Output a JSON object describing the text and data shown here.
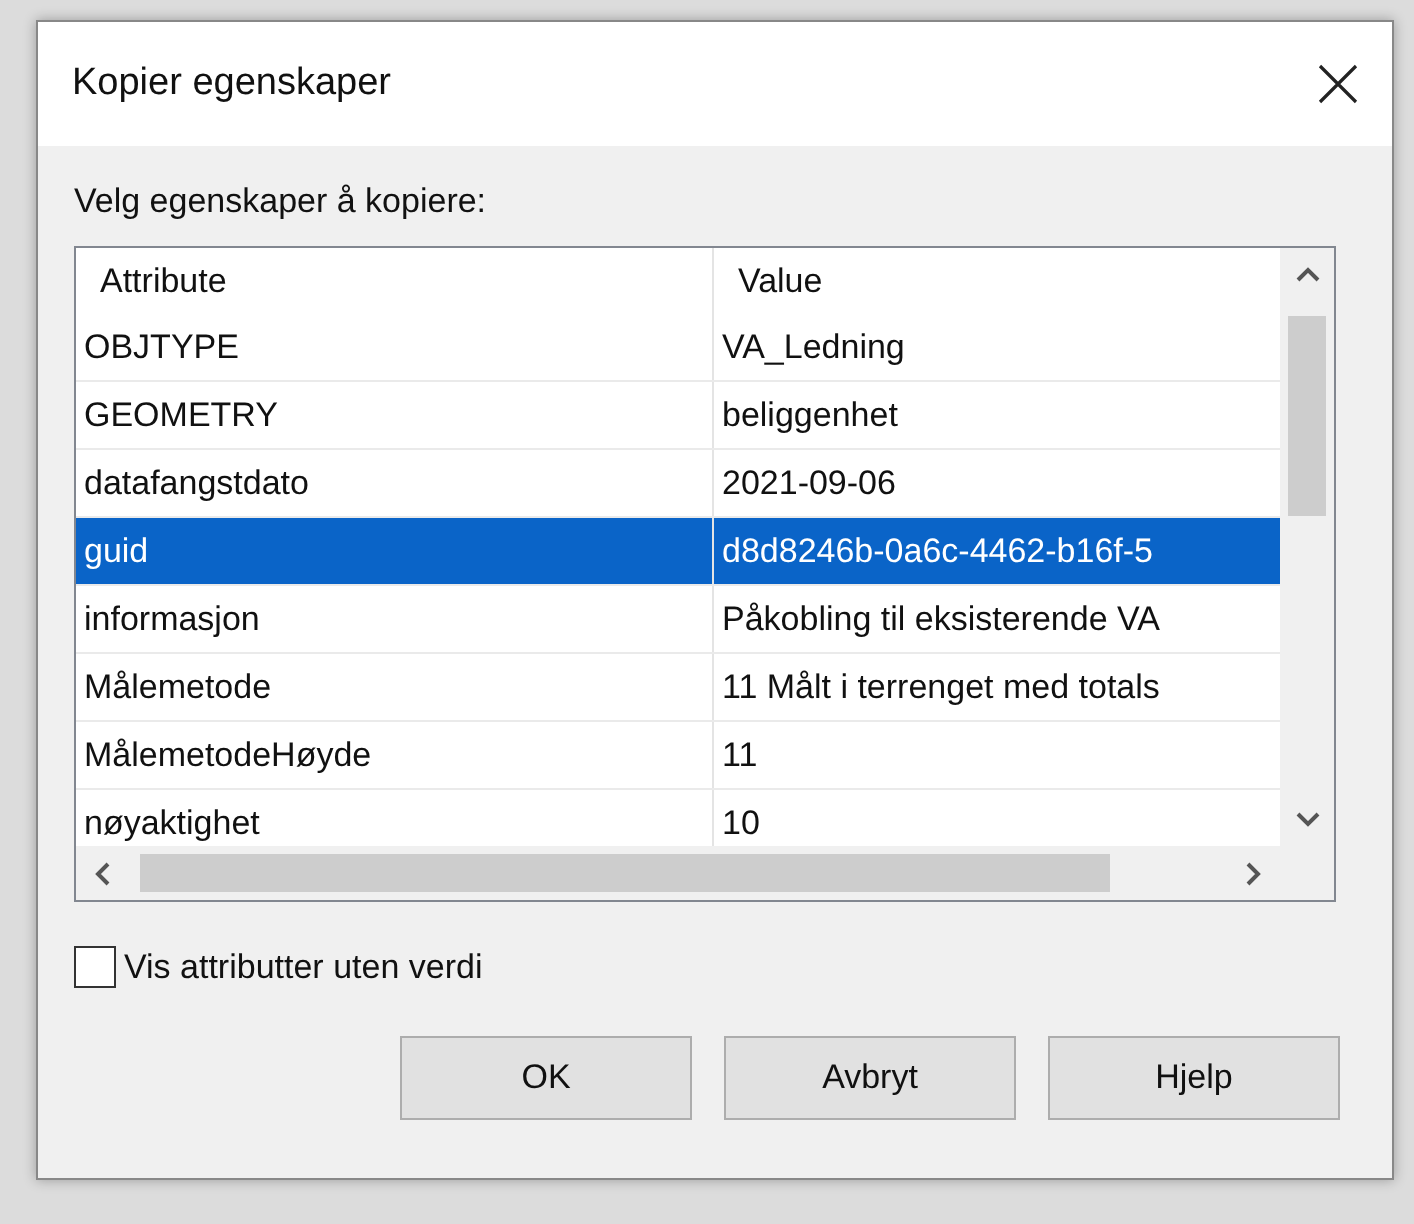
{
  "window": {
    "title": "Kopier egenskaper"
  },
  "prompt": "Velg egenskaper å kopiere:",
  "table": {
    "columns": [
      "Attribute",
      "Value"
    ],
    "rows": [
      {
        "attribute": "OBJTYPE",
        "value": "VA_Ledning",
        "selected": false
      },
      {
        "attribute": "GEOMETRY",
        "value": "beliggenhet",
        "selected": false
      },
      {
        "attribute": "datafangstdato",
        "value": "2021-09-06",
        "selected": false
      },
      {
        "attribute": "guid",
        "value": "d8d8246b-0a6c-4462-b16f-5",
        "selected": true
      },
      {
        "attribute": "informasjon",
        "value": "Påkobling til eksisterende VA",
        "selected": false
      },
      {
        "attribute": "Målemetode",
        "value": "11 Målt i terrenget med totals",
        "selected": false
      },
      {
        "attribute": "MålemetodeHøyde",
        "value": "11",
        "selected": false
      },
      {
        "attribute": "nøyaktighet",
        "value": "10",
        "selected": false
      }
    ]
  },
  "show_empty": {
    "label": "Vis attributter uten verdi",
    "checked": false
  },
  "buttons": [
    "OK",
    "Avbryt",
    "Hjelp"
  ]
}
